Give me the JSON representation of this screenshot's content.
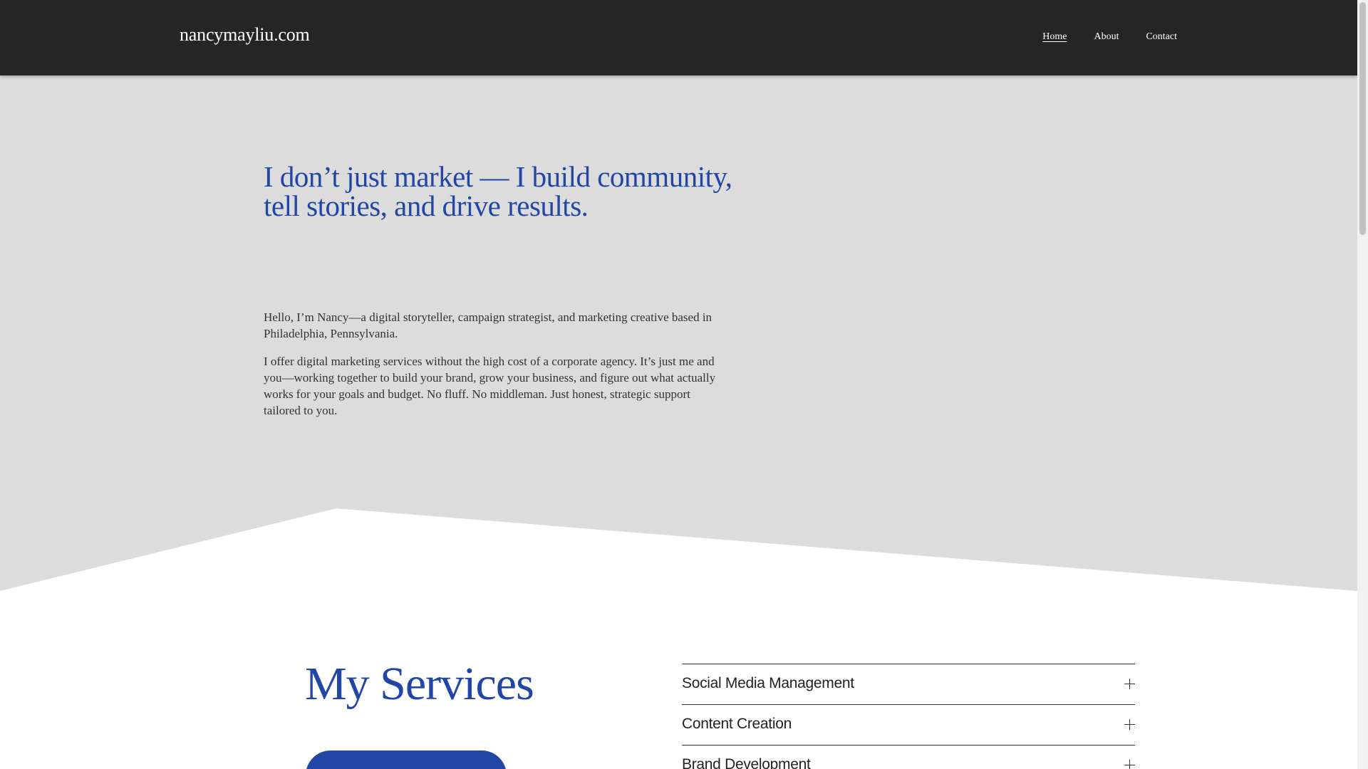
{
  "header": {
    "logo": "nancymayliu.com",
    "nav": [
      {
        "label": "Home",
        "active": true
      },
      {
        "label": "About",
        "active": false
      },
      {
        "label": "Contact",
        "active": false
      }
    ]
  },
  "hero": {
    "heading": "I don’t just market — I  build  community, tell stories, and drive results.",
    "paragraphs": [
      "Hello, I’m Nancy—a digital storyteller, campaign strategist, and marketing creative based in Philadelphia, Pennsylvania.",
      "I offer digital marketing services without the high cost of a corporate agency. It’s just me and you—working together to build your brand, grow your business, and figure out what actually works for your goals and budget. No fluff. No middleman. Just honest, strategic support tailored to you."
    ]
  },
  "services": {
    "title": "My Services",
    "items": [
      {
        "label": "Social Media Management",
        "icon": "plus-icon"
      },
      {
        "label": "Content Creation",
        "icon": "plus-icon"
      },
      {
        "label": "Brand Development",
        "icon": "plus-icon"
      }
    ]
  },
  "colors": {
    "accent": "#2146a5",
    "header_bg": "#252525",
    "hero_bg": "#dcdcdc",
    "page_bg": "#ffffff"
  }
}
